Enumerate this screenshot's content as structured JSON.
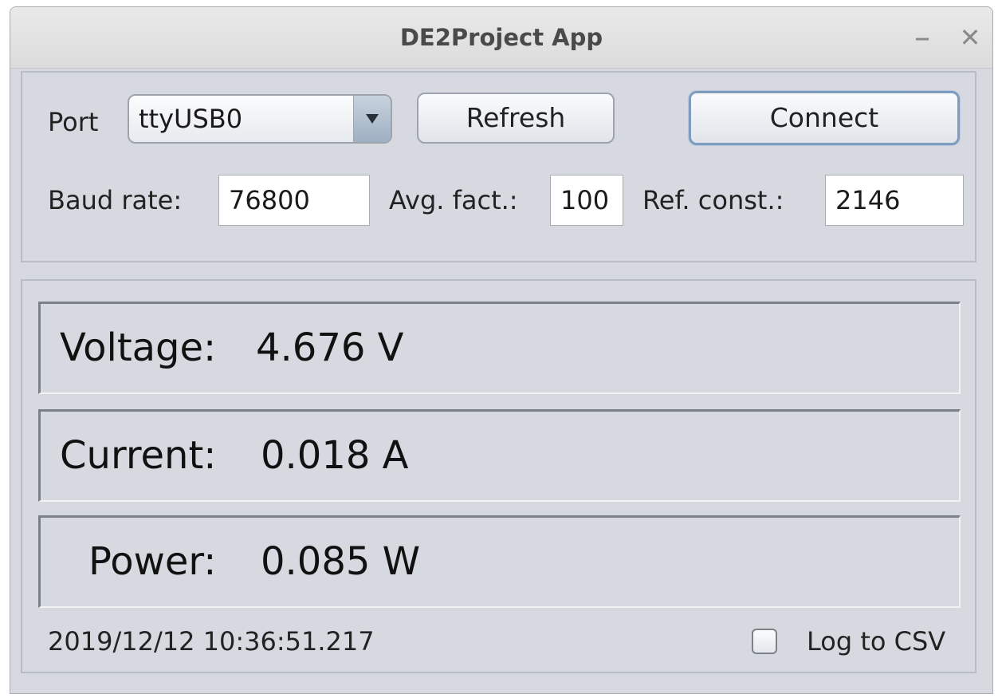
{
  "window": {
    "title": "DE2Project App"
  },
  "titlebar": {
    "minimize_glyph": "–",
    "close_glyph": "✕"
  },
  "connection": {
    "port_label": "Port",
    "port_value": "ttyUSB0",
    "refresh_label": "Refresh",
    "connect_label": "Connect",
    "baud_label": "Baud rate:",
    "baud_value": "76800",
    "avg_label": "Avg. fact.:",
    "avg_value": "100",
    "ref_label": "Ref. const.:",
    "ref_value": "2146"
  },
  "readings": {
    "voltage": {
      "label": "Voltage:",
      "value": "4.676 V"
    },
    "current": {
      "label": "Current:",
      "value": "0.018 A"
    },
    "power": {
      "label": "Power:",
      "value": "0.085 W"
    }
  },
  "status": {
    "timestamp": "2019/12/12 10:36:51.217",
    "log_csv_label": "Log to CSV",
    "log_csv_checked": false
  },
  "icons": {
    "dropdown": "chevron-down-icon",
    "checkbox": "checkbox-icon"
  }
}
